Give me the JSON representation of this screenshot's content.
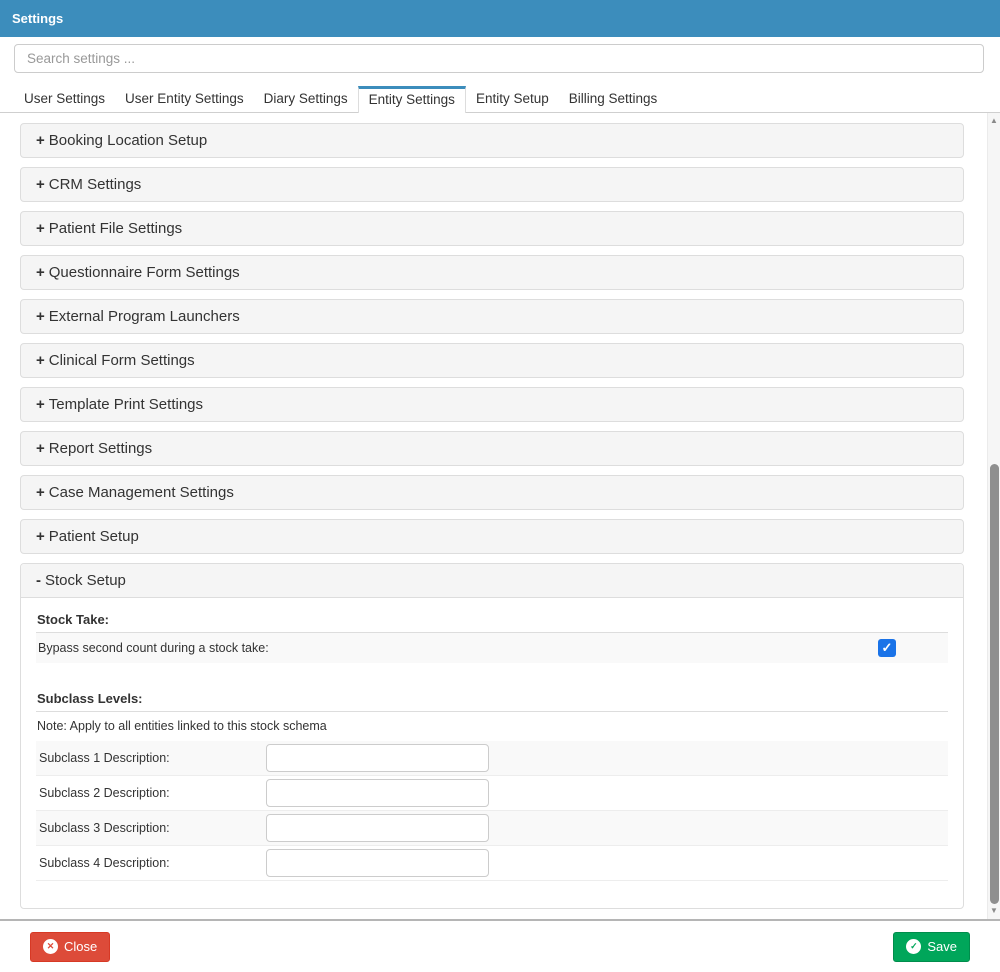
{
  "window": {
    "title": "Settings"
  },
  "search": {
    "placeholder": "Search settings ..."
  },
  "tabs": [
    {
      "label": "User Settings",
      "active": false
    },
    {
      "label": "User Entity Settings",
      "active": false
    },
    {
      "label": "Diary Settings",
      "active": false
    },
    {
      "label": "Entity Settings",
      "active": true
    },
    {
      "label": "Entity Setup",
      "active": false
    },
    {
      "label": "Billing Settings",
      "active": false
    }
  ],
  "accordion": [
    {
      "label": "Booking Location Setup",
      "expanded": false
    },
    {
      "label": "CRM Settings",
      "expanded": false
    },
    {
      "label": "Patient File Settings",
      "expanded": false
    },
    {
      "label": "Questionnaire Form Settings",
      "expanded": false
    },
    {
      "label": "External Program Launchers",
      "expanded": false
    },
    {
      "label": "Clinical Form Settings",
      "expanded": false
    },
    {
      "label": "Template Print Settings",
      "expanded": false
    },
    {
      "label": "Report Settings",
      "expanded": false
    },
    {
      "label": "Case Management Settings",
      "expanded": false
    },
    {
      "label": "Patient Setup",
      "expanded": false
    },
    {
      "label": "Stock Setup",
      "expanded": true
    }
  ],
  "stock_setup": {
    "stock_take": {
      "heading": "Stock Take:",
      "bypass_label": "Bypass second count during a stock take:",
      "bypass_checked": true
    },
    "subclass": {
      "heading": "Subclass Levels:",
      "note": "Note: Apply to all entities linked to this stock schema",
      "fields": [
        {
          "label": "Subclass 1 Description:",
          "value": ""
        },
        {
          "label": "Subclass 2 Description:",
          "value": ""
        },
        {
          "label": "Subclass 3 Description:",
          "value": ""
        },
        {
          "label": "Subclass 4 Description:",
          "value": ""
        }
      ]
    }
  },
  "footer": {
    "close_label": "Close",
    "save_label": "Save"
  },
  "icons": {
    "collapsed_prefix": "+",
    "expanded_prefix": "-",
    "check_glyph": "✓",
    "close_glyph": "✕",
    "scroll_up": "▲",
    "scroll_down": "▼"
  },
  "colors": {
    "header_bar": "#3c8dbc",
    "active_tab_accent": "#3c8dbc",
    "checkbox_blue": "#1a73e8",
    "close_button_red": "#dd4b39",
    "save_button_green": "#00a65a"
  }
}
